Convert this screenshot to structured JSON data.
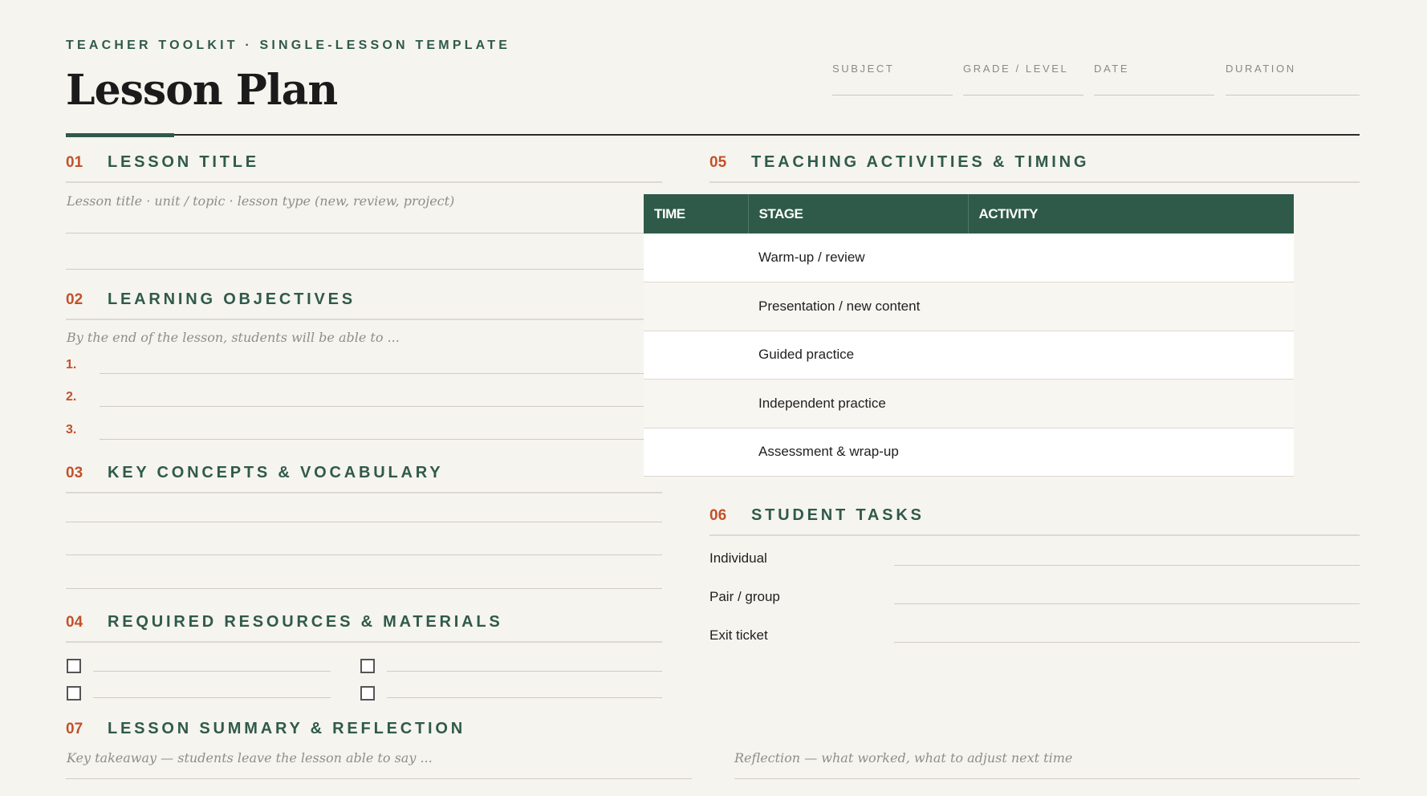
{
  "header": {
    "eyebrow": "TEACHER TOOLKIT · SINGLE-LESSON TEMPLATE",
    "title": "Lesson Plan",
    "fields": [
      "SUBJECT",
      "GRADE / LEVEL",
      "DATE",
      "DURATION"
    ]
  },
  "sections": {
    "s1": {
      "num": "01",
      "name": "LESSON TITLE",
      "hint": "Lesson title · unit / topic · lesson type (new, review, project)"
    },
    "s2": {
      "num": "02",
      "name": "LEARNING OBJECTIVES",
      "hint": "By the end of the lesson, students will be able to ...",
      "items": [
        "1.",
        "2.",
        "3."
      ]
    },
    "s3": {
      "num": "03",
      "name": "KEY CONCEPTS & VOCABULARY"
    },
    "s4": {
      "num": "04",
      "name": "REQUIRED RESOURCES & MATERIALS"
    },
    "s5": {
      "num": "05",
      "name": "TEACHING ACTIVITIES & TIMING",
      "columns": [
        "TIME",
        "STAGE",
        "ACTIVITY"
      ],
      "stages": [
        "Warm-up / review",
        "Presentation / new content",
        "Guided practice",
        "Independent practice",
        "Assessment & wrap-up"
      ]
    },
    "s6": {
      "num": "06",
      "name": "STUDENT TASKS",
      "tasks": [
        "Individual",
        "Pair / group",
        "Exit ticket"
      ]
    },
    "s7": {
      "num": "07",
      "name": "LESSON SUMMARY & REFLECTION",
      "hint_left": "Key takeaway — students leave the lesson able to say ...",
      "hint_right": "Reflection — what worked, what to adjust next time"
    }
  },
  "colors": {
    "accent": "#2f5a4a",
    "number": "#c0522a",
    "background": "#f6f4ef"
  }
}
